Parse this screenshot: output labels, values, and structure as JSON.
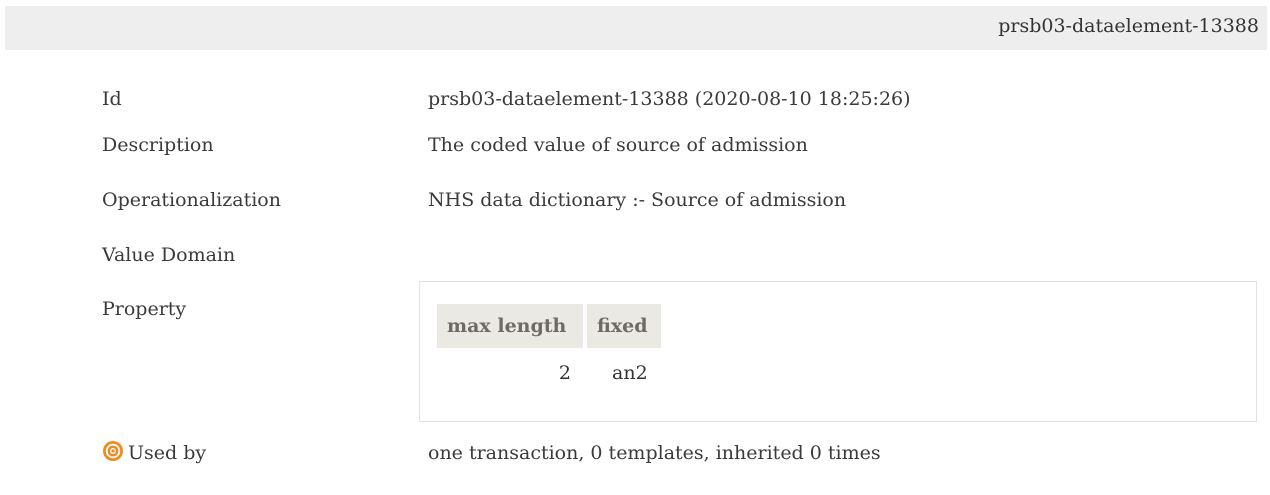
{
  "header": {
    "element_id": "prsb03-dataelement-13388"
  },
  "fields": {
    "id": {
      "label": "Id",
      "value": "prsb03-dataelement-13388 (2020-08-10 18:25:26)"
    },
    "description": {
      "label": "Description",
      "value": "The coded value of source of admission"
    },
    "operationalization": {
      "label": "Operationalization",
      "value": "NHS data dictionary :- Source of admission"
    },
    "value_domain": {
      "label": "Value Domain",
      "value": ""
    },
    "property": {
      "label": "Property",
      "table": {
        "headers": [
          "max length",
          "fixed"
        ],
        "rows": [
          [
            "2",
            "an2"
          ]
        ]
      }
    },
    "used_by": {
      "label": "Used by",
      "icon": "target-icon",
      "value": "one transaction, 0 templates, inherited 0 times"
    }
  },
  "colors": {
    "header_bg": "#eeeeee",
    "table_header_bg": "#ebe9e4",
    "table_header_text": "#6f6a62",
    "icon_orange": "#f08a1c"
  }
}
